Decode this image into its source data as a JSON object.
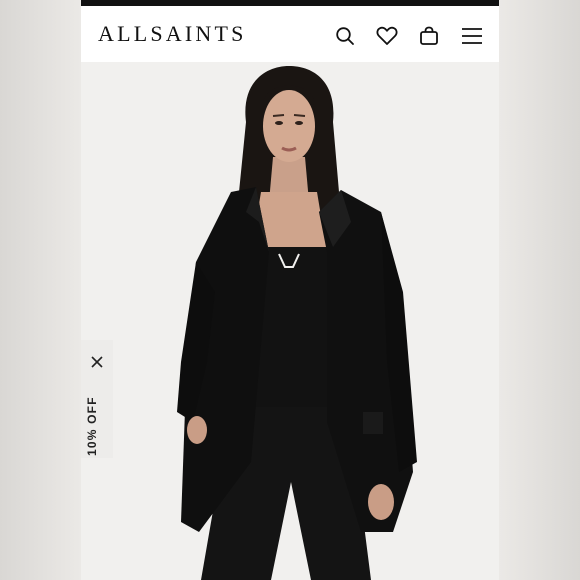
{
  "header": {
    "logo_text": "ALLSAINTS",
    "icons": [
      "search-icon",
      "heart-icon",
      "bag-icon",
      "menu-icon"
    ]
  },
  "promo": {
    "label": "10% OFF",
    "close_icon": "close-icon"
  },
  "colors": {
    "header_bg": "#ffffff",
    "top_strip": "#111111",
    "photo_bg": "#f1f0ee",
    "text": "#111111"
  }
}
